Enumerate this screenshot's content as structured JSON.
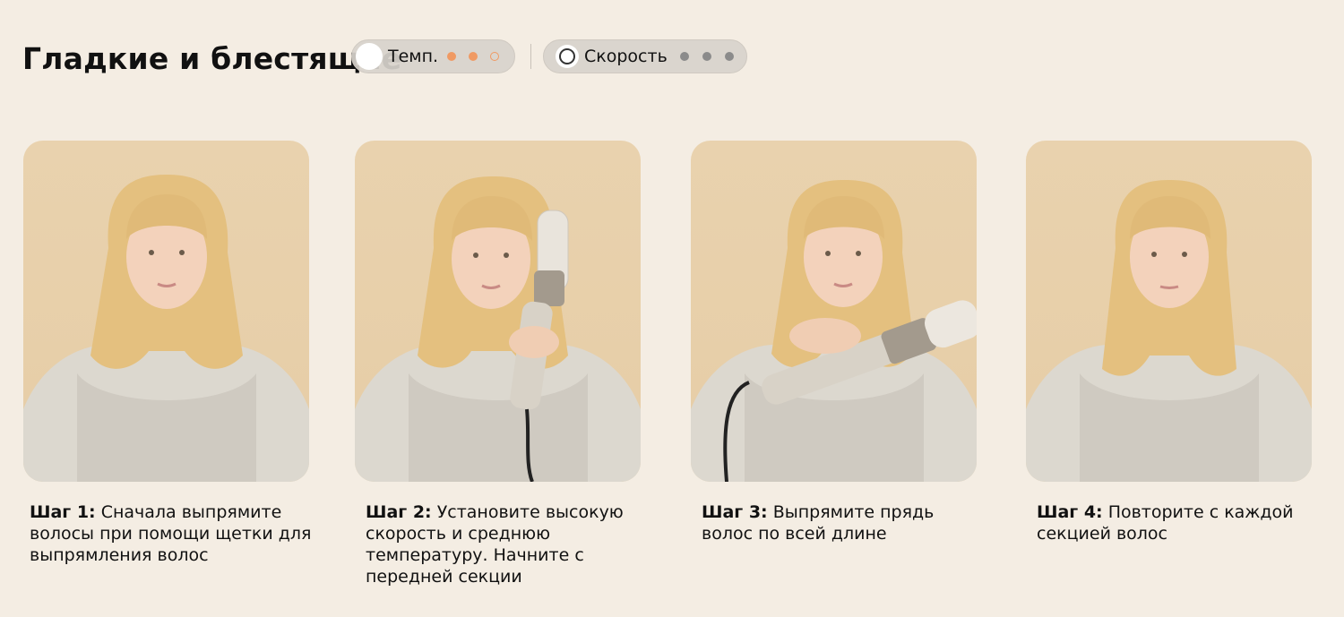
{
  "title": "Гладкие и блестящие",
  "temperature": {
    "label": "Темп.",
    "colors": {
      "active": "#f09a63"
    },
    "level": 2,
    "max_level": 3
  },
  "speed": {
    "label": "Скорость",
    "colors": {
      "active": "#8b8b8b"
    },
    "level": 3,
    "max_level": 3
  },
  "steps": [
    {
      "prefix": "Шаг 1:",
      "text": " Сначала выпрямите волосы при помощи щетки для выпрямления волос"
    },
    {
      "prefix": "Шаг 2:",
      "text": " Установите высокую скорость и среднюю температуру. Начните с передней секции"
    },
    {
      "prefix": "Шаг 3:",
      "text": " Выпрямите прядь волос по всей длине"
    },
    {
      "prefix": "Шаг 4:",
      "text": " Повторите с каждой секцией волос"
    }
  ]
}
